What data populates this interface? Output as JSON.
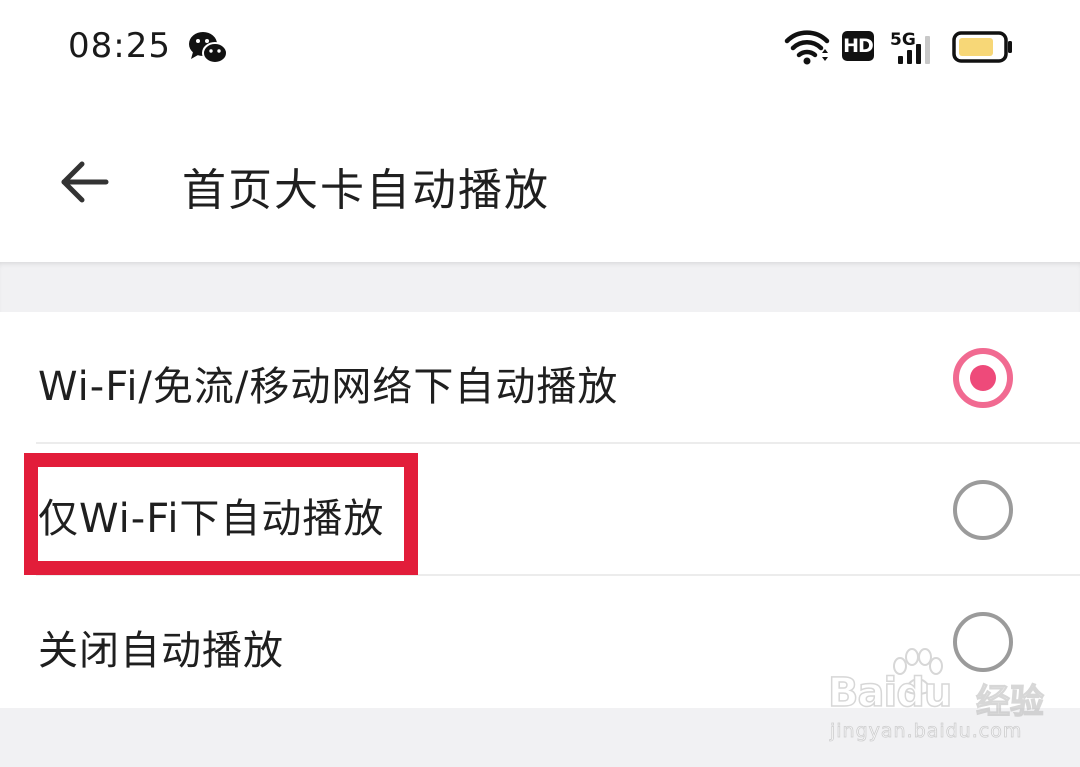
{
  "status_bar": {
    "time": "08:25",
    "hd_label": "HD",
    "network_label": "5G",
    "icons": [
      "wechat-icon",
      "wifi-icon",
      "hd-icon",
      "signal-icon",
      "battery-icon"
    ]
  },
  "header": {
    "title": "首页大卡自动播放",
    "back_icon": "arrow-left-icon"
  },
  "options": [
    {
      "label": "Wi-Fi/免流/移动网络下自动播放",
      "selected": true
    },
    {
      "label": "仅Wi-Fi下自动播放",
      "selected": false
    },
    {
      "label": "关闭自动播放",
      "selected": false
    }
  ],
  "highlight": {
    "target": "仅Wi-Fi下自动播放",
    "color": "#e21d3a"
  },
  "watermark": {
    "brand": "Baidu",
    "brand_cn": "经验",
    "url": "jingyan.baidu.com"
  },
  "colors": {
    "accent": "#ee4a7a",
    "radio_off": "#9b9b9b",
    "band": "#f1f1f3",
    "battery": "#f7d777"
  }
}
